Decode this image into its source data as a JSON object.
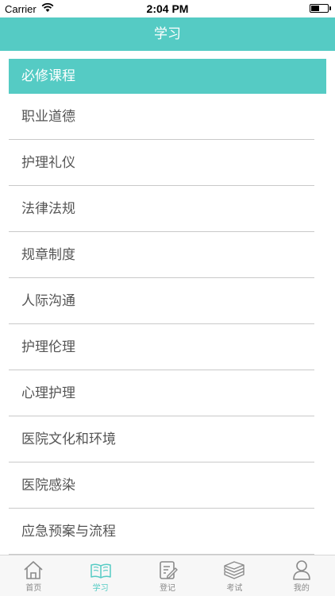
{
  "status_bar": {
    "carrier": "Carrier",
    "time": "2:04 PM",
    "wifi_icon": "wifi-icon",
    "battery_icon": "battery-icon"
  },
  "nav": {
    "title": "学习"
  },
  "section": {
    "title": "必修课程"
  },
  "courses": [
    "职业道德",
    "护理礼仪",
    "法律法规",
    "规章制度",
    "人际沟通",
    "护理伦理",
    "心理护理",
    "医院文化和环境",
    "医院感染",
    "应急预案与流程"
  ],
  "tabs": [
    {
      "label": "首页",
      "icon": "home-icon",
      "active": false
    },
    {
      "label": "学习",
      "icon": "book-icon",
      "active": true
    },
    {
      "label": "登记",
      "icon": "edit-note-icon",
      "active": false
    },
    {
      "label": "考试",
      "icon": "books-stack-icon",
      "active": false
    },
    {
      "label": "我的",
      "icon": "user-icon",
      "active": false
    }
  ],
  "colors": {
    "accent": "#55cbc4",
    "tab_inactive": "#8a8a8a",
    "text": "#555555",
    "divider": "#c9c9c9"
  }
}
